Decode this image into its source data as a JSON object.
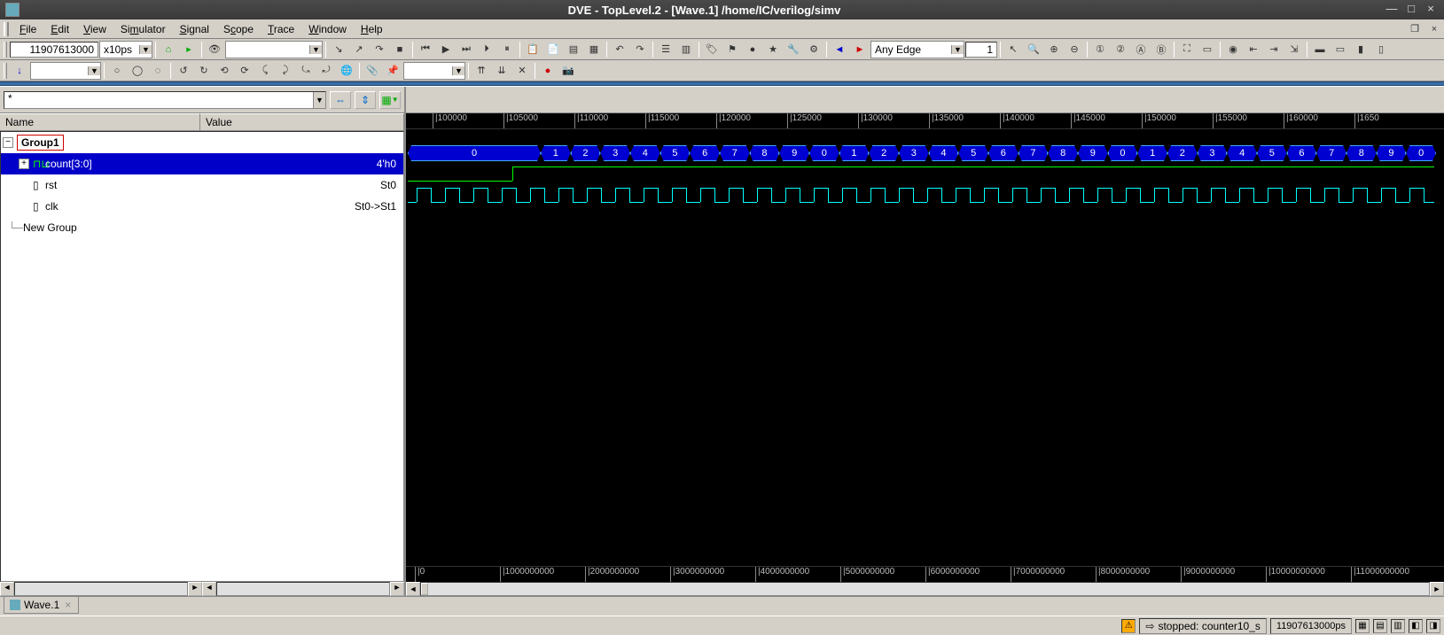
{
  "title": "DVE - TopLevel.2 - [Wave.1]  /home/IC/verilog/simv",
  "menu": [
    "File",
    "Edit",
    "View",
    "Simulator",
    "Signal",
    "Scope",
    "Trace",
    "Window",
    "Help"
  ],
  "toolbar1": {
    "time_value": "11907613000",
    "time_unit": "x10ps",
    "edge_mode": "Any Edge",
    "count_value": "1"
  },
  "left": {
    "search_value": "*",
    "header": {
      "name": "Name",
      "value": "Value"
    },
    "group": "Group1",
    "signals": [
      {
        "name": "count[3:0]",
        "value": "4'h0",
        "selected": true,
        "icon": "bus"
      },
      {
        "name": "rst",
        "value": "St0",
        "icon": "bit"
      },
      {
        "name": "clk",
        "value": "St0->St1",
        "icon": "bit"
      }
    ],
    "new_group": "New Group"
  },
  "ruler_top": [
    "100000",
    "105000",
    "110000",
    "115000",
    "120000",
    "125000",
    "130000",
    "135000",
    "140000",
    "145000",
    "150000",
    "155000",
    "160000",
    "1650"
  ],
  "ruler_bottom": [
    "0",
    "1000000000",
    "2000000000",
    "3000000000",
    "4000000000",
    "5000000000",
    "6000000000",
    "7000000000",
    "8000000000",
    "9000000000",
    "10000000000",
    "11000000000"
  ],
  "bus_values": [
    "0",
    "1",
    "2",
    "3",
    "4",
    "5",
    "6",
    "7",
    "8",
    "9",
    "0",
    "1",
    "2",
    "3",
    "4",
    "5",
    "6",
    "7",
    "8",
    "9",
    "0",
    "1",
    "2",
    "3",
    "4",
    "5",
    "6",
    "7",
    "8",
    "9",
    "0"
  ],
  "tab": {
    "label": "Wave.1"
  },
  "status": {
    "msg": "stopped: counter10_s",
    "time": "11907613000ps"
  }
}
